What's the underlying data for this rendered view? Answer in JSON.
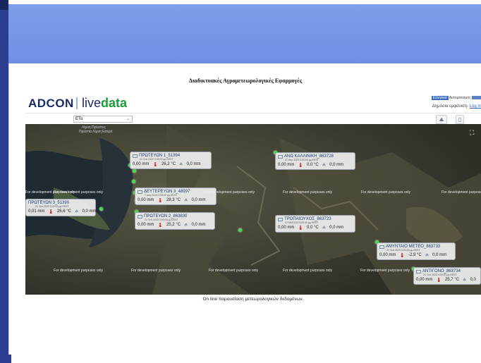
{
  "page": {
    "title": "Διαδικτυακές Αγρομετεωρολογικές Εφαρμογές",
    "caption": "On line παρουσίαση μετεωρολογικών δεδομένων."
  },
  "app": {
    "brand_left": "ADCON",
    "brand_right_prefix": "live",
    "brand_right_suffix": "data",
    "badge": "Ελληνικά",
    "lang": "Αυτοματισμός",
    "public_view": "Δημόσια εμφάνιση-",
    "login": "Log in"
  },
  "toolbar": {
    "parameter": "ETo"
  },
  "map": {
    "dev_label": "For development purposes only",
    "place_labels": [
      "Λίμνη Πρέσπες",
      "Πρέσπα Λίμνη Εσερό"
    ]
  },
  "stations": [
    {
      "name": "ΠΡΩΤΕΥΩΝ 1_51394",
      "date": "21 Ξεπ 2023 3:30:00 μμ EEST",
      "rain": "0,00 mm",
      "temp": "26,2 °C",
      "leaf": "0,0 mm"
    },
    {
      "name": "ΑΝΩ ΚΑΛΛΙΝΙΚΗ_863728",
      "date": "27 Απρ 2023 3:00:00 μμ EEST",
      "rain": "0,00 mm",
      "temp": "0,0 °C",
      "leaf": "0,0 mm"
    },
    {
      "name": "ΔΕΥΤΕΡΕΥΩΝ 3_48997",
      "date": "7 Απρ 2023 2:00:00 μμ EEST",
      "rain": "0,00 mm",
      "temp": "28,3 °C",
      "leaf": "0,0 mm"
    },
    {
      "name": "ΠΡΩΤΕΥΩΝ 3_51390",
      "date": "21 Ξεπ 2023 3:30:00 μμ EEST",
      "rain": "0,01 mm",
      "temp": "26,6 °C",
      "leaf": "0,0 mm"
    },
    {
      "name": "ΠΡΩΤΕΥΩΝ 2_863830",
      "date": "21 Ξεπ 2023 3:00:00 μμ EEST",
      "rain": "0,00 mm",
      "temp": "25,2 °C",
      "leaf": "0,0 mm"
    },
    {
      "name": "ΤΡΟΠΑΙΟΥΧΟΣ_863723",
      "date": "22 Μαΐ 2023 5:00:00 μμ EEST",
      "rain": "0,00 mm",
      "temp": "0,0 °C",
      "leaf": "0,0 mm"
    },
    {
      "name": "ΑΜΥΝΤΑΙΟ ΜΕΤΕΟ_863733",
      "date": "21 Ξεπ 2023 3:30:00 μμ EEST",
      "rain": "0,00 mm",
      "temp": "-2,9 °C",
      "leaf": "0,0 mm"
    },
    {
      "name": "ΑΝΤΙΓΟΝΟ_863734",
      "date": "21 Ξεπ 2023 4:00:00 μμ EEST",
      "rain": "0,00 mm",
      "temp": "25,7 °C",
      "leaf": "0,0"
    }
  ],
  "colors": {
    "top_band": "#7e9ee8",
    "brand_navy": "#1b2a6b",
    "brand_green": "#1a9c3a",
    "marker": "#3ee04a"
  }
}
